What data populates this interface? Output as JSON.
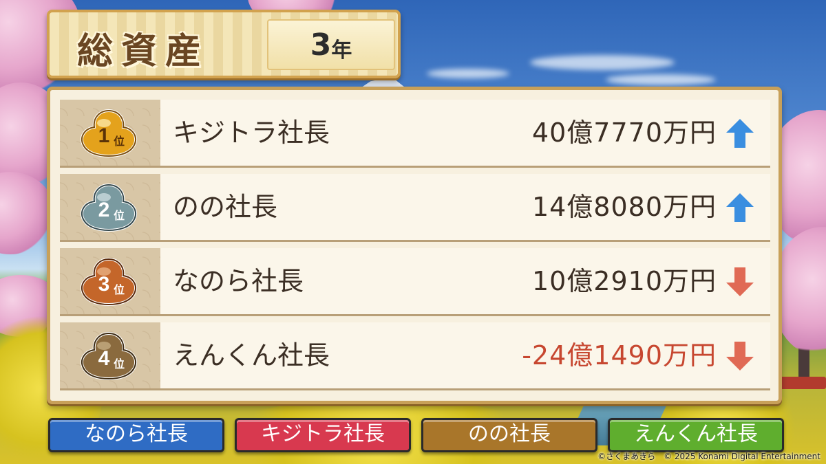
{
  "title": {
    "label": "総資産",
    "year_number": "3",
    "year_unit": "年"
  },
  "rankings": [
    {
      "rank": "1",
      "rank_suffix": "位",
      "name": "キジトラ社長",
      "amount": "40億7770万円",
      "trend": "up",
      "negative": false
    },
    {
      "rank": "2",
      "rank_suffix": "位",
      "name": "のの社長",
      "amount": "14億8080万円",
      "trend": "up",
      "negative": false
    },
    {
      "rank": "3",
      "rank_suffix": "位",
      "name": "なのら社長",
      "amount": "10億2910万円",
      "trend": "down",
      "negative": false
    },
    {
      "rank": "4",
      "rank_suffix": "位",
      "name": "えんくん社長",
      "amount": "-24億1490万円",
      "trend": "down",
      "negative": true
    }
  ],
  "player_tabs": [
    {
      "label": "なのら社長",
      "color": "#2f6cc4"
    },
    {
      "label": "キジトラ社長",
      "color": "#d8394f"
    },
    {
      "label": "のの社長",
      "color": "#a9762a"
    },
    {
      "label": "えんくん社長",
      "color": "#5fae2e"
    }
  ],
  "colors": {
    "badge_gold": "#e4a21c",
    "badge_silver": "#7a9aa0",
    "badge_bronze": "#c4662a",
    "badge_fourth": "#8a6a3e",
    "arrow_up": "#3a8ee0",
    "arrow_down": "#e06a55",
    "negative_amount": "#c74730"
  },
  "copyright": "©さくまあきら　© 2025 Konami Digital Entertainment"
}
